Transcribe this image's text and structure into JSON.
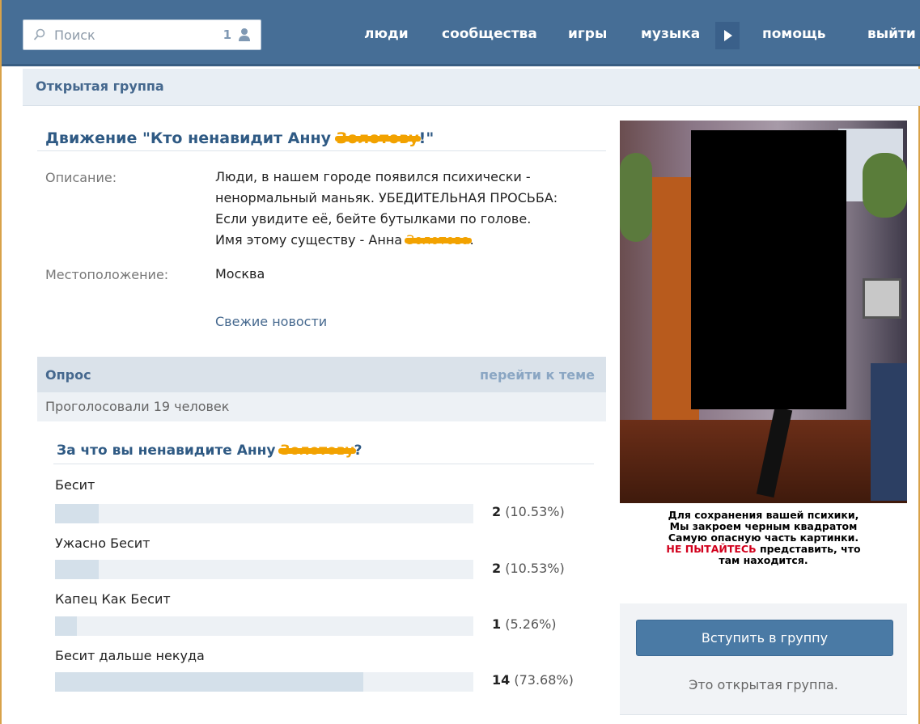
{
  "topbar": {
    "search_placeholder": "Поиск",
    "search_count": "1",
    "nav": [
      {
        "label": "люди"
      },
      {
        "label": "сообщества"
      },
      {
        "label": "игры"
      },
      {
        "label": "музыка"
      },
      {
        "label": "помощь"
      },
      {
        "label": "выйти"
      }
    ]
  },
  "group_type": "Открытая группа",
  "group": {
    "title_prefix": "Движение \"Кто ненавидит Анну ",
    "title_redacted": "Золотову",
    "title_suffix": "!\"",
    "description_label": "Описание:",
    "description_lines": [
      "Люди, в нашем городе появился психически -",
      "ненормальный маньяк. УБЕДИТЕЛЬНАЯ ПРОСЬБА:",
      "Если увидите её, бейте бутылками по голове."
    ],
    "description_last_prefix": "Имя этому существу - Анна ",
    "description_last_redacted": "Золотова",
    "description_last_suffix": ".",
    "location_label": "Местоположение:",
    "location_value": "Москва",
    "news_link": "Свежие новости"
  },
  "poll": {
    "header": "Опрос",
    "goto": "перейти к теме",
    "voted": "Проголосовали 19 человек",
    "question_prefix": "За что вы ненавидите Анну ",
    "question_redacted": "Золотову",
    "question_suffix": "?",
    "options": [
      {
        "label": "Бесит",
        "count": "2",
        "percent_text": "(10.53%)",
        "fraction": 0.1053
      },
      {
        "label": "Ужасно Бесит",
        "count": "2",
        "percent_text": "(10.53%)",
        "fraction": 0.1053
      },
      {
        "label": "Капец Как Бесит",
        "count": "1",
        "percent_text": "(5.26%)",
        "fraction": 0.0526
      },
      {
        "label": "Бесит дальше некуда",
        "count": "14",
        "percent_text": "(73.68%)",
        "fraction": 0.7368
      }
    ]
  },
  "sidebar": {
    "caption_lines": [
      "Для сохранения вашей психики,",
      "Мы закроем черным квадратом",
      "Самую опасную часть картинки."
    ],
    "caption_warning": "НЕ ПЫТАЙТЕСЬ",
    "caption_after_warning": " представить, что",
    "caption_last": "там находится.",
    "join_button": "Вступить в группу",
    "join_note": "Это открытая группа."
  },
  "colors": {
    "topbar": "#466e96",
    "link": "#45688e",
    "redaction": "#f2a200",
    "warning": "#d1001c"
  }
}
